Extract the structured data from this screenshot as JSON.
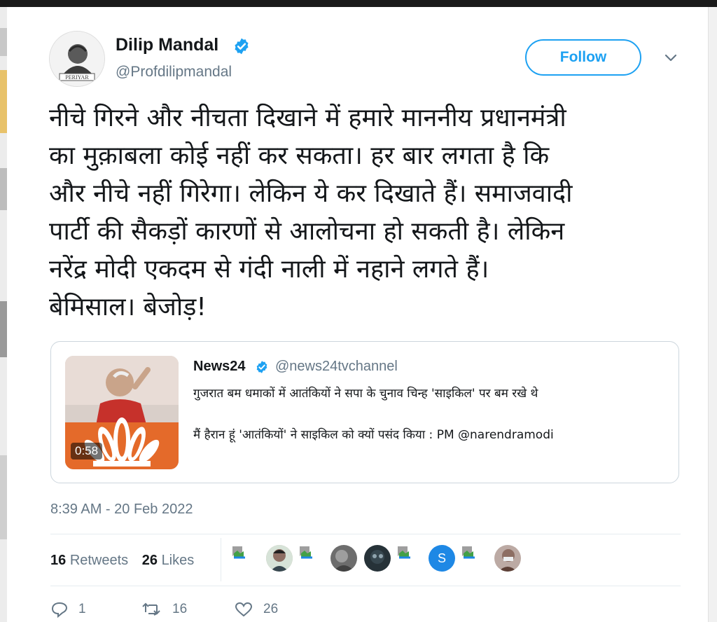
{
  "author": {
    "name": "Dilip Mandal",
    "handle": "@Profdilipmandal",
    "avatar_caption": "PERIYAR"
  },
  "follow_label": "Follow",
  "tweet_lines": [
    "नीचे गिरने और नीचता दिखाने में हमारे माननीय प्रधानमंत्री",
    "का मुक़ाबला कोई नहीं कर सकता। हर बार लगता है कि",
    "और नीचे नहीं गिरेगा। लेकिन ये कर दिखाते हैं। समाजवादी",
    "पार्टी की सैकड़ों कारणों से आलोचना हो सकती है। लेकिन",
    "नरेंद्र मोदी एकदम से गंदी नाली में नहाने लगते हैं।",
    "बेमिसाल। बेजोड़!"
  ],
  "quote": {
    "name": "News24",
    "handle": "@news24tvchannel",
    "line1": "गुजरात बम धमाकों में आतंकियों ने सपा के चुनाव चिन्ह 'साइकिल' पर बम रखे थे",
    "line2": "मैं हैरान हूं 'आतंकियों' ने साइकिल को क्यों पसंद किया : PM @narendramodi",
    "video_duration": "0:58"
  },
  "timestamp": "8:39 AM - 20 Feb 2022",
  "stats": {
    "retweets_count": "16",
    "retweets_label": "Retweets",
    "likes_count": "26",
    "likes_label": "Likes"
  },
  "likers": [
    "broken-image",
    "photo",
    "broken-image",
    "photo",
    "photo",
    "broken-image",
    "letter-S",
    "broken-image",
    "photo"
  ],
  "liker_letter": "S",
  "actions": {
    "reply_count": "1",
    "retweet_count": "16",
    "like_count": "26"
  },
  "colors": {
    "accent": "#1da1f2",
    "text": "#14171a",
    "muted": "#657786",
    "border": "#ccd6dd"
  },
  "icons": [
    "verified-icon",
    "chevron-down-icon",
    "reply-icon",
    "retweet-icon",
    "like-icon",
    "broken-image-icon"
  ]
}
